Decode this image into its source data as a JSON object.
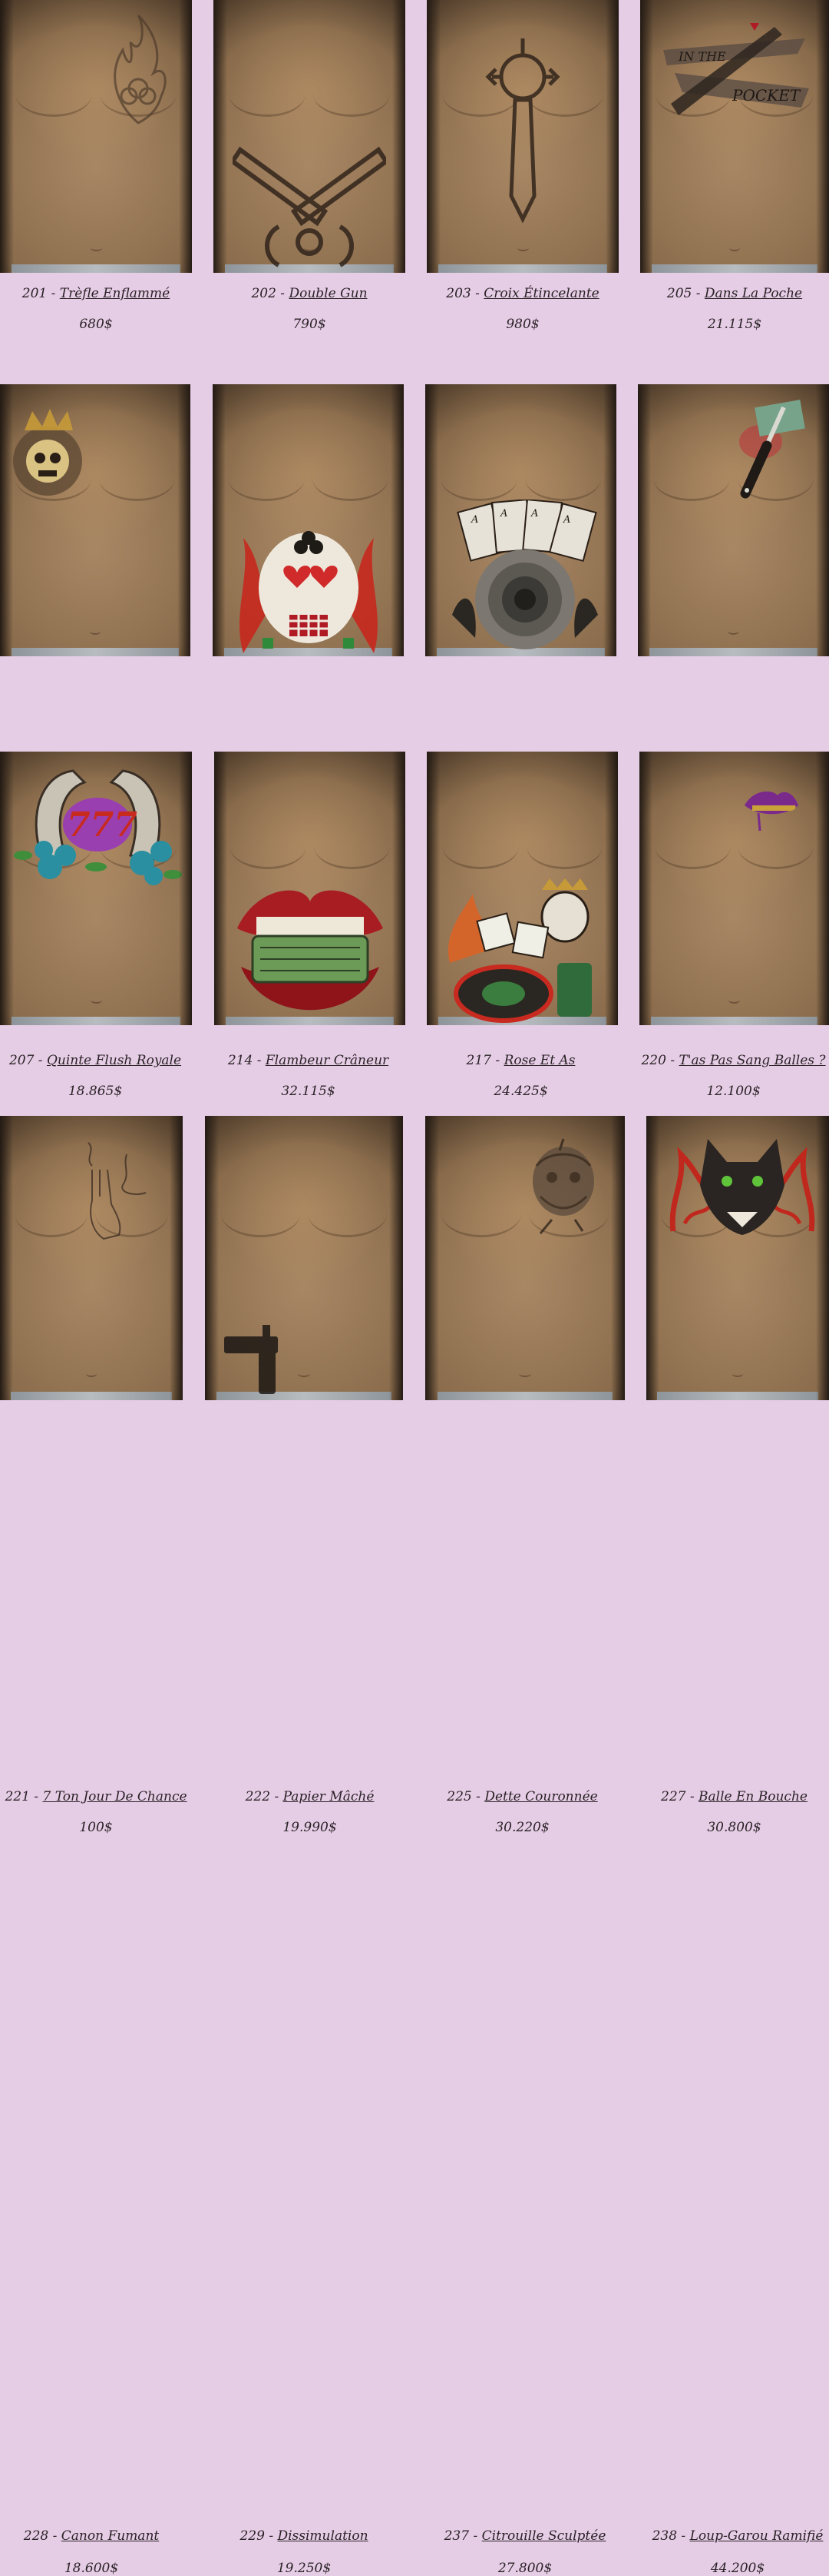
{
  "rows": [
    {
      "items": [
        {
          "number": "201",
          "name": "Trèfle Enflammé",
          "price": "680$",
          "tattoo": "flaming-clover-icon"
        },
        {
          "number": "202",
          "name": "Double Gun",
          "price": "790$",
          "tattoo": "crossed-guns-icon"
        },
        {
          "number": "203",
          "name": "Croix Étincelante",
          "price": "980$",
          "tattoo": "sparkling-cross-icon"
        },
        {
          "number": "205",
          "name": "Dans La Poche",
          "price": "21.115$",
          "tattoo": "in-the-pocket-knife-icon",
          "tattoo_text": [
            "IN THE",
            "POCKET"
          ]
        }
      ]
    },
    {
      "items": [
        {
          "number": "207",
          "name": "Quinte Flush Royale",
          "price": "18.865$",
          "tattoo": "crowned-skull-icon"
        },
        {
          "number": "214",
          "name": "Flambeur Crâneur",
          "price": "32.115$",
          "tattoo": "club-skull-flames-icon"
        },
        {
          "number": "217",
          "name": "Rose Et As",
          "price": "24.425$",
          "tattoo": "rose-aces-icon",
          "tattoo_text": [
            "A",
            "A",
            "A",
            "A"
          ]
        },
        {
          "number": "220",
          "name": "T'as Pas Sang Balles ?",
          "price": "12.100$",
          "tattoo": "knife-money-icon"
        }
      ]
    },
    {
      "items": [
        {
          "number": "221",
          "name": "7 Ton Jour De Chance",
          "price": "100$",
          "tattoo": "lucky-777-horseshoe-icon",
          "tattoo_text": [
            "777"
          ]
        },
        {
          "number": "222",
          "name": "Papier Mâché",
          "price": "19.990$",
          "tattoo": "lips-money-icon"
        },
        {
          "number": "225",
          "name": "Dette Couronnée",
          "price": "30.220$",
          "tattoo": "crowned-dice-roulette-icon"
        },
        {
          "number": "227",
          "name": "Balle En Bouche",
          "price": "30.800$",
          "tattoo": "bullet-lips-icon"
        }
      ]
    },
    {
      "items": [
        {
          "number": "228",
          "name": "Canon Fumant",
          "price": "18.600$",
          "tattoo": "smoking-finger-gun-icon"
        },
        {
          "number": "229",
          "name": "Dissimulation",
          "price": "19.250$",
          "tattoo": "hidden-pistol-icon"
        },
        {
          "number": "237",
          "name": "Citrouille Sculptée",
          "price": "27.800$",
          "tattoo": "carved-pumpkin-icon"
        },
        {
          "number": "238",
          "name": "Loup-Garou Ramifié",
          "price": "44.200$",
          "tattoo": "werewolf-tribal-icon"
        }
      ]
    }
  ],
  "separator": " - ",
  "colors": {
    "background": "#e6cde6",
    "text": "#2a2226",
    "skin": "#a88764"
  }
}
